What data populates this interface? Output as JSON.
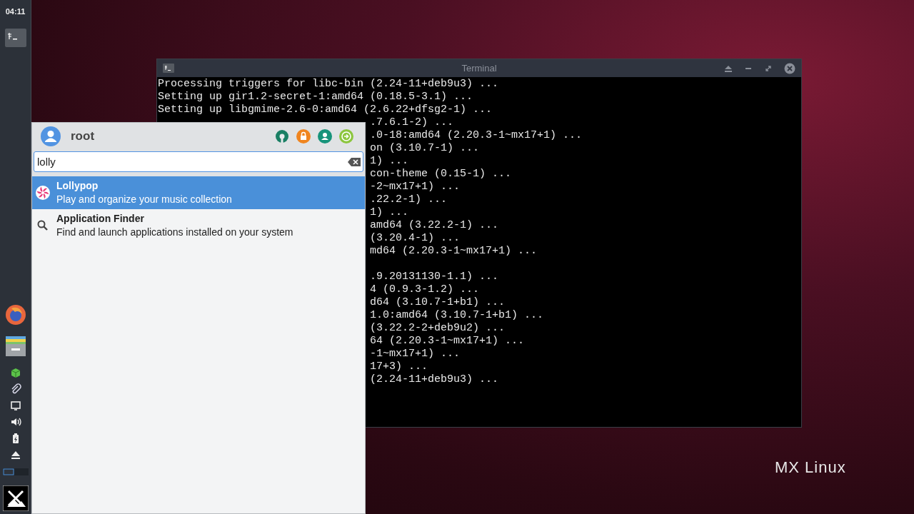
{
  "panel": {
    "clock": "04:11"
  },
  "terminal": {
    "title": "Terminal",
    "lines": [
      "Processing triggers for libc-bin (2.24-11+deb9u3) ...",
      "Setting up gir1.2-secret-1:amd64 (0.18.5-3.1) ...",
      "Setting up libgmime-2.6-0:amd64 (2.6.22+dfsg2-1) ..."
    ],
    "covered_lines": [
      ".7.6.1-2) ...",
      ".0-18:amd64 (2.20.3-1~mx17+1) ...",
      "on (3.10.7-1) ...",
      "1) ...",
      "con-theme (0.15-1) ...",
      "-2~mx17+1) ...",
      ".22.2-1) ...",
      "1) ...",
      "amd64 (3.22.2-1) ...",
      "(3.20.4-1) ...",
      "md64 (2.20.3-1~mx17+1) ..."
    ],
    "covered_lines_after_blank": [
      ".9.20131130-1.1) ...",
      "4 (0.9.3-1.2) ...",
      "d64 (3.10.7-1+b1) ...",
      "1.0:amd64 (3.10.7-1+b1) ...",
      "(3.22.2-2+deb9u2) ...",
      "64 (2.20.3-1~mx17+1) ...",
      "-1~mx17+1) ...",
      "17+3) ...",
      "(2.24-11+deb9u3) ..."
    ]
  },
  "menu": {
    "user": "root",
    "search": {
      "value": "lolly"
    },
    "results": [
      {
        "kind": "application",
        "title": "Lollypop",
        "description": "Play and organize your music collection",
        "selected": true
      },
      {
        "kind": "search-action",
        "title": "Application Finder",
        "description": "Find and launch applications installed on your system",
        "selected": false
      }
    ]
  },
  "wallpaper_logo": "MX Linux"
}
